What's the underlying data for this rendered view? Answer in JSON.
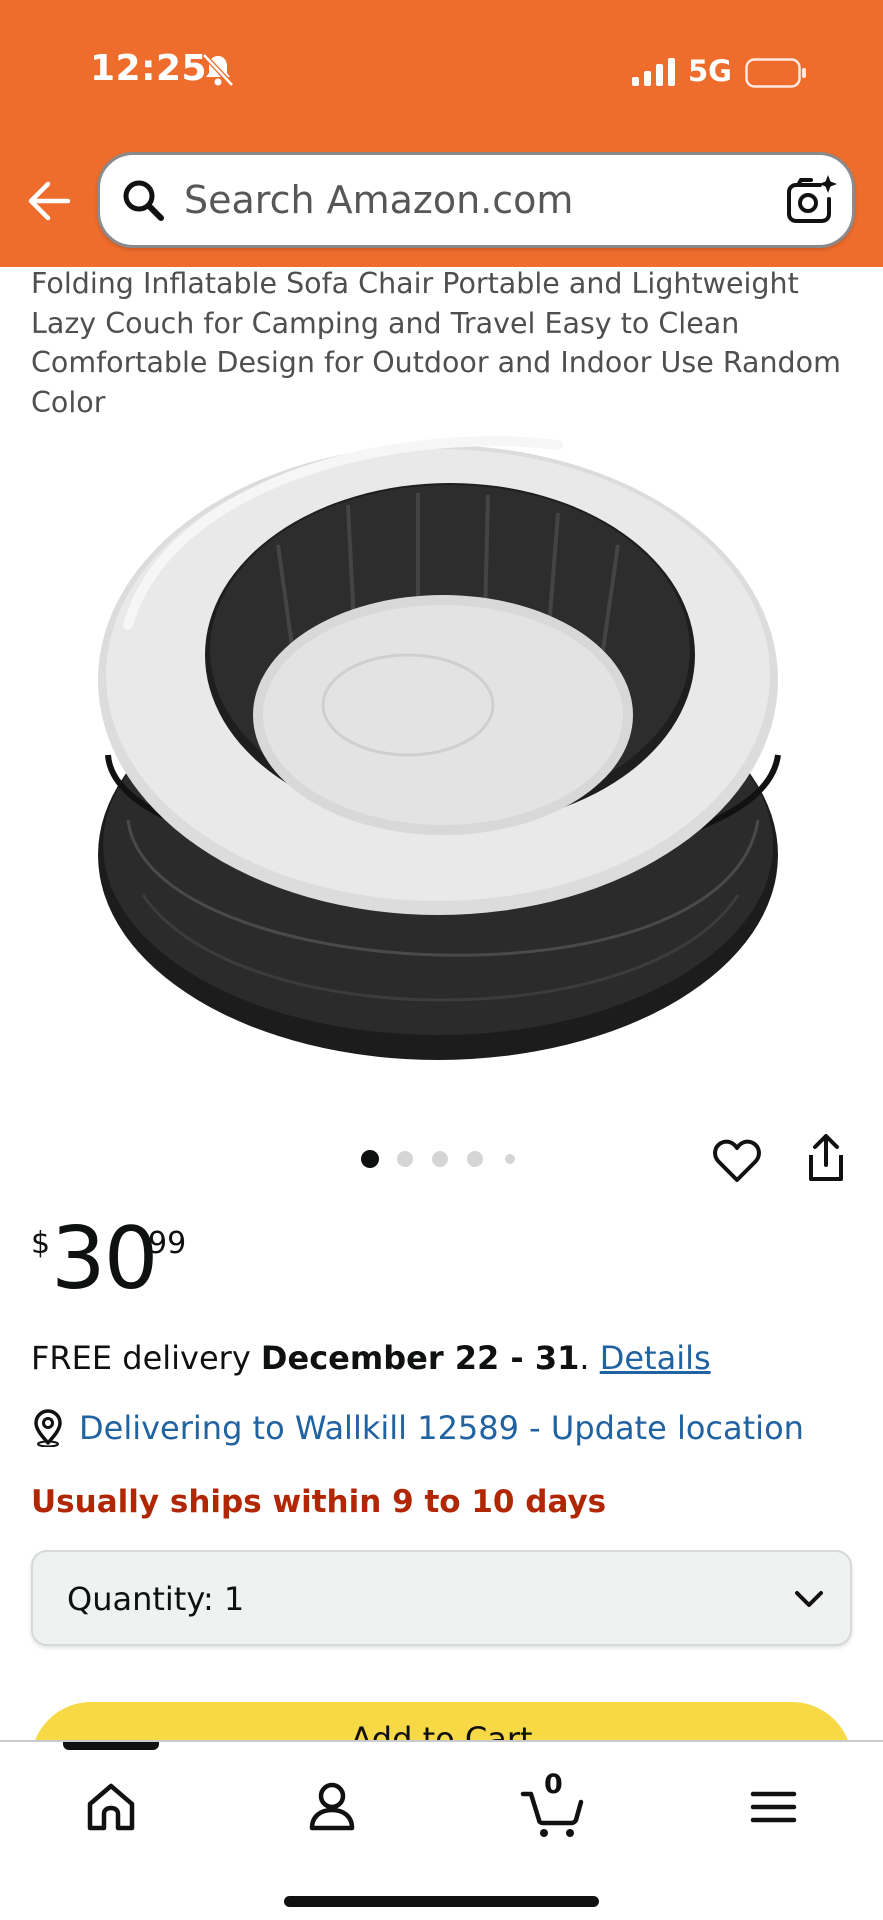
{
  "status_bar": {
    "time": "12:25",
    "network": "5G"
  },
  "search": {
    "placeholder": "Search Amazon.com"
  },
  "product": {
    "title": "Folding Inflatable Sofa Chair Portable and Lightweight Lazy Couch for Camping and Travel Easy to Clean Comfortable Design for Outdoor and Indoor Use Random Color",
    "image_count": 5,
    "active_image_index": 0
  },
  "price": {
    "symbol": "$",
    "whole": "30",
    "fraction": "99"
  },
  "delivery": {
    "prefix": "FREE delivery ",
    "dates": "December 22 - 31",
    "separator": ". ",
    "details_link": "Details",
    "location": "Delivering to Wallkill 12589 - Update location",
    "ships_note": "Usually ships within 9 to 10 days"
  },
  "quantity": {
    "label": "Quantity:",
    "value": "1"
  },
  "add_to_cart": {
    "label": "Add to Cart"
  },
  "bottom_nav": {
    "cart_count": "0",
    "items": [
      "home",
      "account",
      "cart",
      "menu"
    ]
  },
  "colors": {
    "header_orange": "#ee6c2c",
    "link_blue": "#2162a1",
    "ship_red": "#b12704",
    "cart_yellow": "#f7d946"
  }
}
